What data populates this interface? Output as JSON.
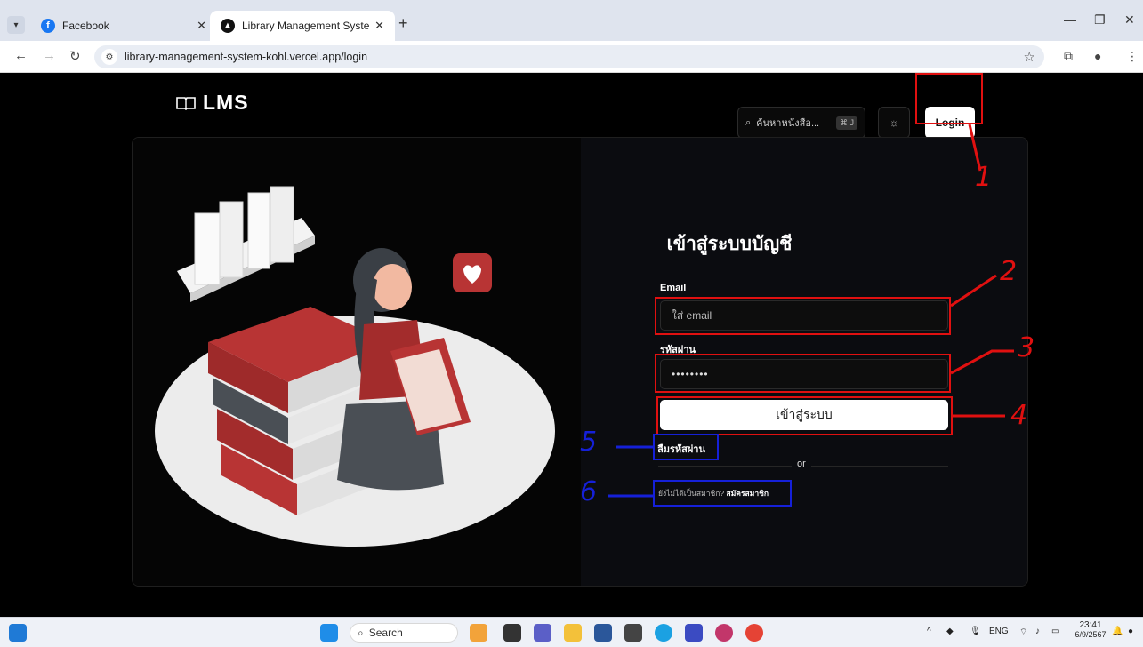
{
  "browser": {
    "tabs": [
      {
        "title": "Facebook",
        "icon": "facebook-icon",
        "color": "#1877f2"
      },
      {
        "title": "Library Management System",
        "icon": "app-icon",
        "color": "#111111"
      }
    ],
    "url": "library-management-system-kohl.vercel.app/login"
  },
  "header": {
    "logo": "LMS",
    "search_placeholder": "ค้นหาหนังสือ...",
    "search_shortcut": "⌘ J",
    "login_label": "Login"
  },
  "form": {
    "title": "เข้าสู่ระบบบัญชี",
    "email_label": "Email",
    "email_placeholder": "ใส่ email",
    "password_label": "รหัสผ่าน",
    "password_value": "••••••••",
    "submit_label": "เข้าสู่ระบบ",
    "forgot_label": "ลืมรหัสผ่าน",
    "or_label": "or",
    "signup_prompt": "ยังไม่ได้เป็นสมาชิก?",
    "signup_link": "สมัครสมาชิก"
  },
  "annotations": {
    "red": [
      "1",
      "2",
      "3",
      "4"
    ],
    "blue": [
      "5",
      "6"
    ],
    "red_color": "#e01010",
    "blue_color": "#1520d8"
  },
  "taskbar": {
    "search_label": "Search",
    "lang": "ENG",
    "time": "23:41",
    "date": "6/9/2567"
  }
}
